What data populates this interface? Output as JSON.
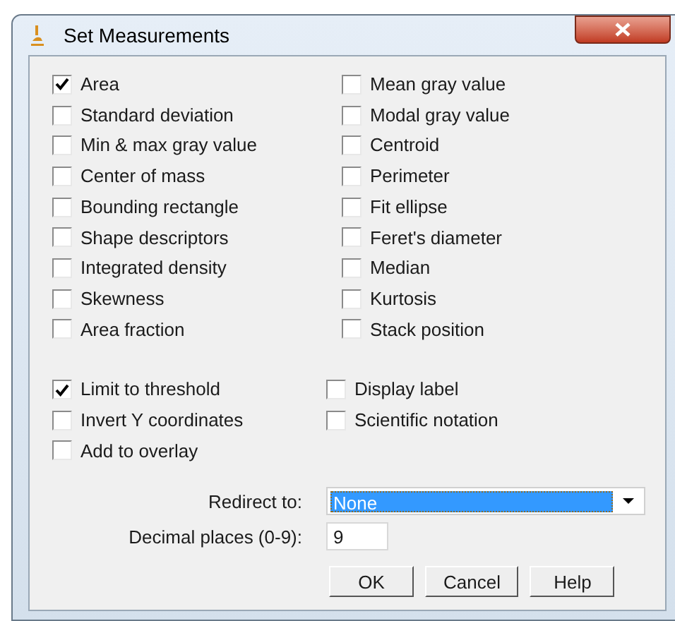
{
  "window": {
    "title": "Set Measurements"
  },
  "measurements": [
    {
      "label": "Area",
      "checked": true
    },
    {
      "label": "Mean gray value",
      "checked": false
    },
    {
      "label": "Standard deviation",
      "checked": false
    },
    {
      "label": "Modal gray value",
      "checked": false
    },
    {
      "label": "Min & max gray value",
      "checked": false
    },
    {
      "label": "Centroid",
      "checked": false
    },
    {
      "label": "Center of mass",
      "checked": false
    },
    {
      "label": "Perimeter",
      "checked": false
    },
    {
      "label": "Bounding rectangle",
      "checked": false
    },
    {
      "label": "Fit ellipse",
      "checked": false
    },
    {
      "label": "Shape descriptors",
      "checked": false
    },
    {
      "label": "Feret's diameter",
      "checked": false
    },
    {
      "label": "Integrated density",
      "checked": false
    },
    {
      "label": "Median",
      "checked": false
    },
    {
      "label": "Skewness",
      "checked": false
    },
    {
      "label": "Kurtosis",
      "checked": false
    },
    {
      "label": "Area fraction",
      "checked": false
    },
    {
      "label": "Stack position",
      "checked": false
    }
  ],
  "options": [
    {
      "label": "Limit to threshold",
      "checked": true
    },
    {
      "label": "Display label",
      "checked": false
    },
    {
      "label": "Invert Y coordinates",
      "checked": false
    },
    {
      "label": "Scientific notation",
      "checked": false
    },
    {
      "label": "Add to overlay",
      "checked": false
    }
  ],
  "redirect": {
    "label": "Redirect to:",
    "value": "None"
  },
  "decimal": {
    "label": "Decimal places (0-9):",
    "value": "9"
  },
  "buttons": [
    "OK",
    "Cancel",
    "Help"
  ]
}
